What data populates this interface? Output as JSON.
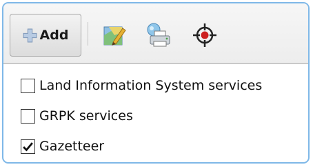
{
  "toolbar": {
    "add_label": "Add",
    "icons": [
      "map-edit-icon",
      "print-icon",
      "crosshair-icon"
    ]
  },
  "layers": [
    {
      "label": "Land Information System services",
      "checked": false
    },
    {
      "label": "GRPK services",
      "checked": false
    },
    {
      "label": "Gazetteer",
      "checked": true
    }
  ],
  "colors": {
    "panel_border": "#7fb8e8",
    "plus_icon": "#8fa8c8",
    "check_mark": "#111111"
  }
}
